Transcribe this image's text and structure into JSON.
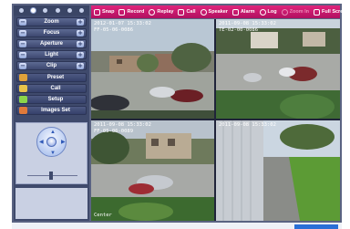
{
  "controls": [
    {
      "label": "Zoom",
      "minus": "−",
      "plus": "+"
    },
    {
      "label": "Focus",
      "minus": "−",
      "plus": "+"
    },
    {
      "label": "Aperture",
      "minus": "−",
      "plus": "+"
    },
    {
      "label": "Light",
      "minus": "−",
      "plus": "+"
    },
    {
      "label": "Clip",
      "minus": "−",
      "plus": "+"
    }
  ],
  "options": [
    {
      "label": "Preset",
      "icon": "preset-icon",
      "color": "#e0a23a"
    },
    {
      "label": "Call",
      "icon": "call-icon",
      "color": "#e8c44a"
    },
    {
      "label": "Setup",
      "icon": "setup-icon",
      "color": "#8bd64a"
    },
    {
      "label": "Images Set",
      "icon": "images-set-icon",
      "color": "#e07a3a"
    }
  ],
  "toolbar": [
    {
      "label": "Snap",
      "icon": "snap-icon",
      "enabled": true
    },
    {
      "label": "Record",
      "icon": "record-icon",
      "enabled": true
    },
    {
      "label": "Replay",
      "icon": "replay-icon",
      "enabled": true
    },
    {
      "label": "Call",
      "icon": "call-icon",
      "enabled": true
    },
    {
      "label": "Speaker",
      "icon": "speaker-icon",
      "enabled": true
    },
    {
      "label": "Alarm",
      "icon": "alarm-icon",
      "enabled": true
    },
    {
      "label": "Log",
      "icon": "log-icon",
      "enabled": true
    },
    {
      "label": "Zoom In",
      "icon": "zoom-in-icon",
      "enabled": false
    },
    {
      "label": "Full Screen",
      "icon": "full-screen-icon",
      "enabled": true
    }
  ],
  "cameras": [
    {
      "timestamp": "2012-01-07 15:33:02",
      "line2": "FF-05-06-0086",
      "bottom": ""
    },
    {
      "timestamp": "2011-09-08 15:33:02",
      "line2": "TE-02-00-0086",
      "bottom": ""
    },
    {
      "timestamp": "2011-09-08 15:33:02",
      "line2": "FF-05-06-0089",
      "bottom": "Center"
    },
    {
      "timestamp": "2011-09-08 15:33:02",
      "line2": "",
      "bottom": ""
    }
  ],
  "colors": {
    "toolbar_bg": "#c8146c",
    "panel_bg": "#3f4a6c",
    "frame_bg": "#5a6382"
  }
}
